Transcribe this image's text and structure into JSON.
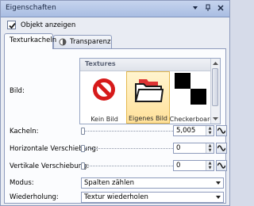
{
  "panel": {
    "title": "Eigenschaften"
  },
  "visibility": {
    "label": "Objekt anzeigen",
    "checked": true
  },
  "tabs": [
    {
      "label": "Texturkacheln",
      "active": true
    },
    {
      "label": "Transparenz",
      "active": false
    }
  ],
  "image_field": {
    "label": "Bild:",
    "gallery_header": "Textures",
    "items": [
      {
        "label": "Kein Bild",
        "icon": "no-image-icon",
        "selected": false
      },
      {
        "label": "Eigenes Bild",
        "icon": "folder-icon",
        "selected": true
      },
      {
        "label": "Checkerboard",
        "icon": "checkerboard-icon",
        "selected": false
      }
    ]
  },
  "tiles": {
    "label": "Kacheln:",
    "value": "5,005"
  },
  "horizontal_offset": {
    "label": "Horizontale Verschiebung:",
    "value": "0"
  },
  "vertical_offset": {
    "label": "Vertikale Verschiebung:",
    "value": "0"
  },
  "mode": {
    "label": "Modus:",
    "value": "Spalten zählen"
  },
  "repeat": {
    "label": "Wiederholung:",
    "value": "Textur wiederholen"
  },
  "colors": {
    "accent_selected": "#ffe19a",
    "border": "#8e9bbc",
    "titlebar": "#b6c7e8"
  }
}
